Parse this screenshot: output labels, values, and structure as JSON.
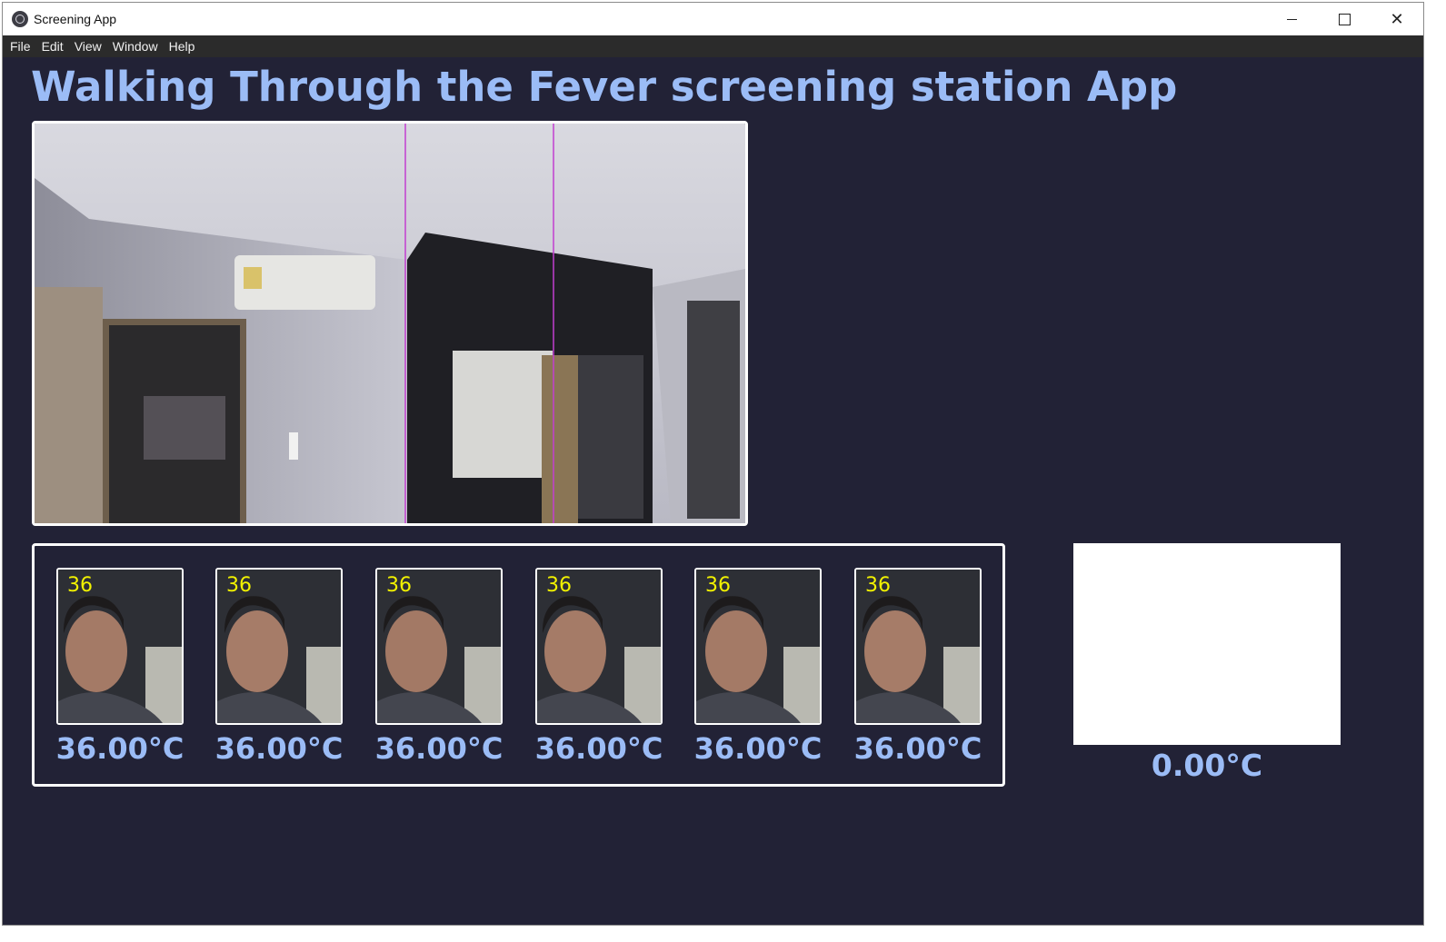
{
  "window": {
    "title": "Screening App"
  },
  "menu": [
    "File",
    "Edit",
    "View",
    "Window",
    "Help"
  ],
  "page": {
    "title": "Walking Through the Fever screening station App"
  },
  "captures": [
    {
      "overlay": "36",
      "temperature": "36.00°C"
    },
    {
      "overlay": "36",
      "temperature": "36.00°C"
    },
    {
      "overlay": "36",
      "temperature": "36.00°C"
    },
    {
      "overlay": "36",
      "temperature": "36.00°C"
    },
    {
      "overlay": "36",
      "temperature": "36.00°C"
    },
    {
      "overlay": "36",
      "temperature": "36.00°C"
    }
  ],
  "current": {
    "temperature": "0.00°C"
  },
  "colors": {
    "background": "#222236",
    "accent": "#9bbcf6",
    "guide_line": "#c23fd0",
    "overlay_text": "#f2f200"
  }
}
